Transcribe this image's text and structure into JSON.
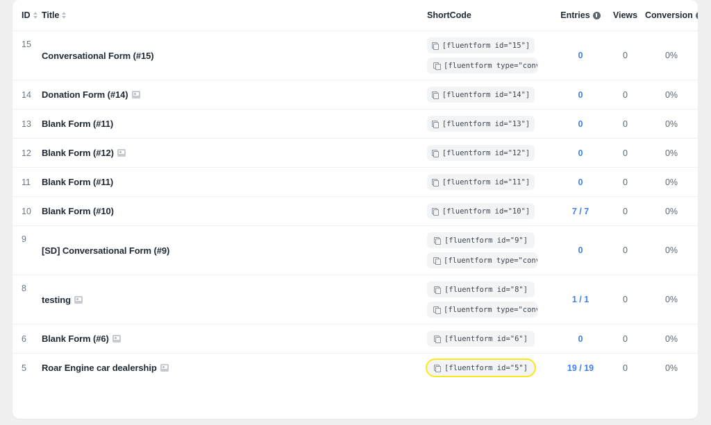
{
  "table": {
    "columns": [
      {
        "key": "id",
        "label": "ID",
        "sortable": true,
        "info": false
      },
      {
        "key": "title",
        "label": "Title",
        "sortable": true,
        "info": false
      },
      {
        "key": "shortcode",
        "label": "ShortCode",
        "sortable": false,
        "info": false
      },
      {
        "key": "entries",
        "label": "Entries",
        "sortable": false,
        "info": true
      },
      {
        "key": "views",
        "label": "Views",
        "sortable": false,
        "info": false
      },
      {
        "key": "conversion",
        "label": "Conversion",
        "sortable": false,
        "info": true
      }
    ],
    "rows": [
      {
        "id": "15",
        "title": "Conversational Form (#15)",
        "has_badge": false,
        "shortcodes": [
          "[fluentform id=\"15\"]",
          "[fluentform type=\"conve…"
        ],
        "entries": "0",
        "views": "0",
        "conversion": "0%",
        "highlight": false
      },
      {
        "id": "14",
        "title": "Donation Form (#14)",
        "has_badge": true,
        "shortcodes": [
          "[fluentform id=\"14\"]"
        ],
        "entries": "0",
        "views": "0",
        "conversion": "0%",
        "highlight": false
      },
      {
        "id": "13",
        "title": "Blank Form (#11)",
        "has_badge": false,
        "shortcodes": [
          "[fluentform id=\"13\"]"
        ],
        "entries": "0",
        "views": "0",
        "conversion": "0%",
        "highlight": false
      },
      {
        "id": "12",
        "title": "Blank Form (#12)",
        "has_badge": true,
        "shortcodes": [
          "[fluentform id=\"12\"]"
        ],
        "entries": "0",
        "views": "0",
        "conversion": "0%",
        "highlight": false
      },
      {
        "id": "11",
        "title": "Blank Form (#11)",
        "has_badge": false,
        "shortcodes": [
          "[fluentform id=\"11\"]"
        ],
        "entries": "0",
        "views": "0",
        "conversion": "0%",
        "highlight": false
      },
      {
        "id": "10",
        "title": "Blank Form (#10)",
        "has_badge": false,
        "shortcodes": [
          "[fluentform id=\"10\"]"
        ],
        "entries": "7 / 7",
        "views": "0",
        "conversion": "0%",
        "highlight": false
      },
      {
        "id": "9",
        "title": "[SD] Conversational Form (#9)",
        "has_badge": false,
        "shortcodes": [
          "[fluentform id=\"9\"]",
          "[fluentform type=\"conve…"
        ],
        "entries": "0",
        "views": "0",
        "conversion": "0%",
        "highlight": false
      },
      {
        "id": "8",
        "title": "testing",
        "has_badge": true,
        "shortcodes": [
          "[fluentform id=\"8\"]",
          "[fluentform type=\"conve…"
        ],
        "entries": "1 / 1",
        "views": "0",
        "conversion": "0%",
        "highlight": false
      },
      {
        "id": "6",
        "title": "Blank Form (#6)",
        "has_badge": true,
        "shortcodes": [
          "[fluentform id=\"6\"]"
        ],
        "entries": "0",
        "views": "0",
        "conversion": "0%",
        "highlight": false
      },
      {
        "id": "5",
        "title": "Roar Engine car dealership",
        "has_badge": true,
        "shortcodes": [
          "[fluentform id=\"5\"]"
        ],
        "entries": "19 / 19",
        "views": "0",
        "conversion": "0%",
        "highlight": true
      }
    ]
  },
  "colors": {
    "page_background": "#f0f0f1",
    "card_background": "#ffffff",
    "link_blue": "#3c7ff2",
    "highlight_yellow": "#ffe81a",
    "text_primary": "#1f2933",
    "text_muted": "#6b7682",
    "shortcode_background": "#f3f4f5"
  }
}
